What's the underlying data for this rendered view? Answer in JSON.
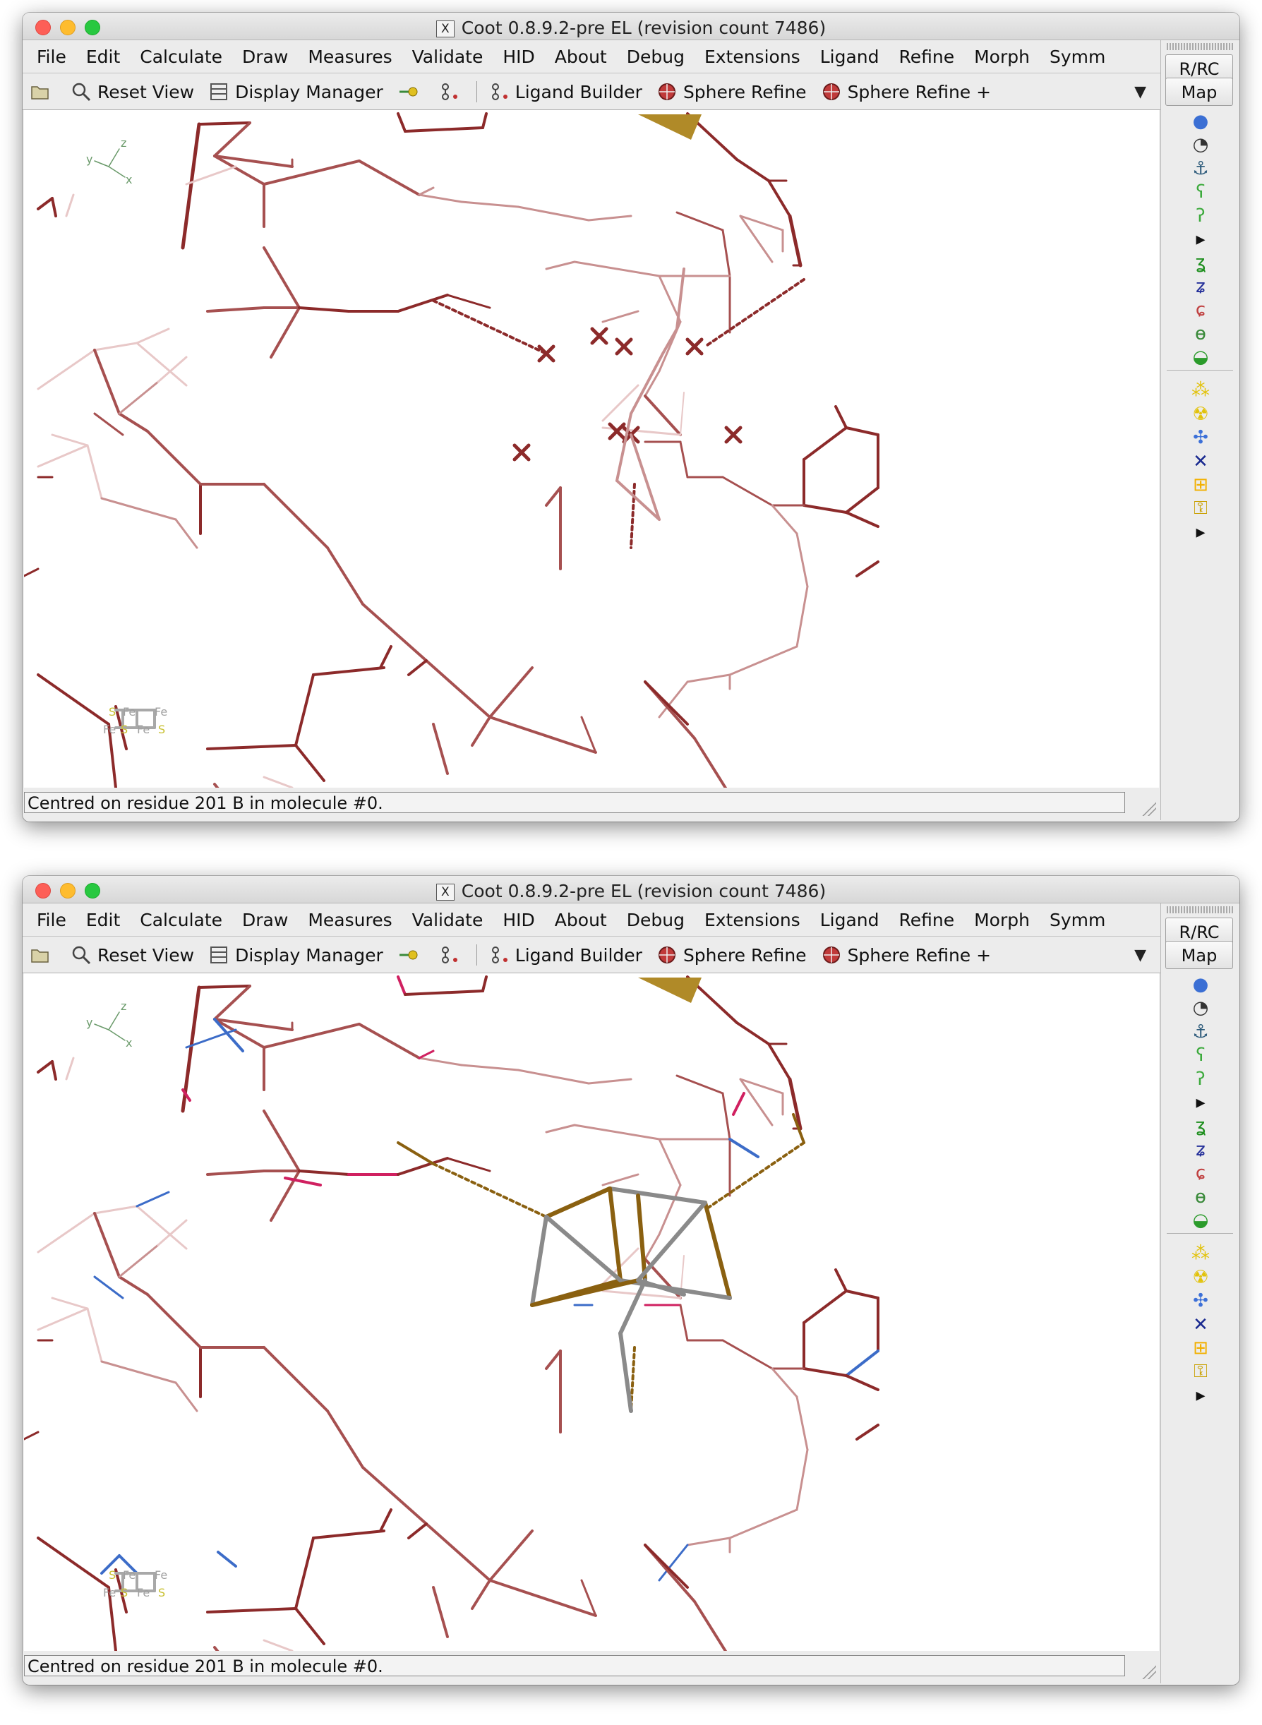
{
  "windows": [
    {
      "title": "Coot 0.8.9.2-pre EL (revision count 7486)",
      "status": "Centred on residue 201 B in molecule #0.",
      "variant": "dummy-atoms"
    },
    {
      "title": "Coot 0.8.9.2-pre EL (revision count 7486)",
      "status": "Centred on residue 201 B in molecule #0.",
      "variant": "cluster-placed"
    }
  ],
  "menu": [
    "File",
    "Edit",
    "Calculate",
    "Draw",
    "Measures",
    "Validate",
    "HID",
    "About",
    "Debug",
    "Extensions",
    "Ligand",
    "Refine",
    "Morph",
    "Symm"
  ],
  "toolbar": {
    "open_icon": "folder-open-icon",
    "reset_view": "Reset View",
    "display_manager": "Display Manager",
    "ligand_builder": "Ligand Builder",
    "sphere_refine": "Sphere Refine",
    "sphere_refine_plus": "Sphere Refine +"
  },
  "sidebar": {
    "buttons": [
      "R/RC",
      "Map"
    ],
    "icons": [
      "rotate-translate-zone-icon",
      "auto-fit-rotamer-icon",
      "anchor-icon",
      "rigid-body-fit-icon",
      "regularize-icon",
      "more-arrow-icon",
      "add-terminal-residue-icon",
      "mutate-icon",
      "refine-zone-icon",
      "autofit-icon",
      "side-chain-icon",
      "add-atom-yellow-icon",
      "radiation-icon",
      "add-alt-conf-icon",
      "delete-icon",
      "add-box-icon",
      "lock-icon",
      "more-arrow-icon"
    ],
    "icon_colors": [
      "#3b6fd4",
      "#333333",
      "#2c5a7a",
      "#3caa3c",
      "#3caa3c",
      "#111111",
      "#1f8f1f",
      "#25309a",
      "#c04040",
      "#3a8a3a",
      "#2b9b2b",
      "#e2c20a",
      "#e2c20a",
      "#3c70d8",
      "#1a2a90",
      "#f2b000",
      "#c9a000",
      "#111111"
    ]
  },
  "axes_label": {
    "x": "x",
    "y": "y",
    "z": "z"
  },
  "iron_sulfur_legend": {
    "fe": "Fe",
    "s": "S"
  },
  "colors": {
    "bond_dark": "#8c2a2a",
    "bond_mid": "#a65050",
    "bond_light": "#c89090",
    "bond_faint": "#e8c8c8",
    "nitrogen": "#3c6cc8",
    "oxygen": "#d02060",
    "sulfur": "#8a6010",
    "iron": "#8a8a8a"
  }
}
